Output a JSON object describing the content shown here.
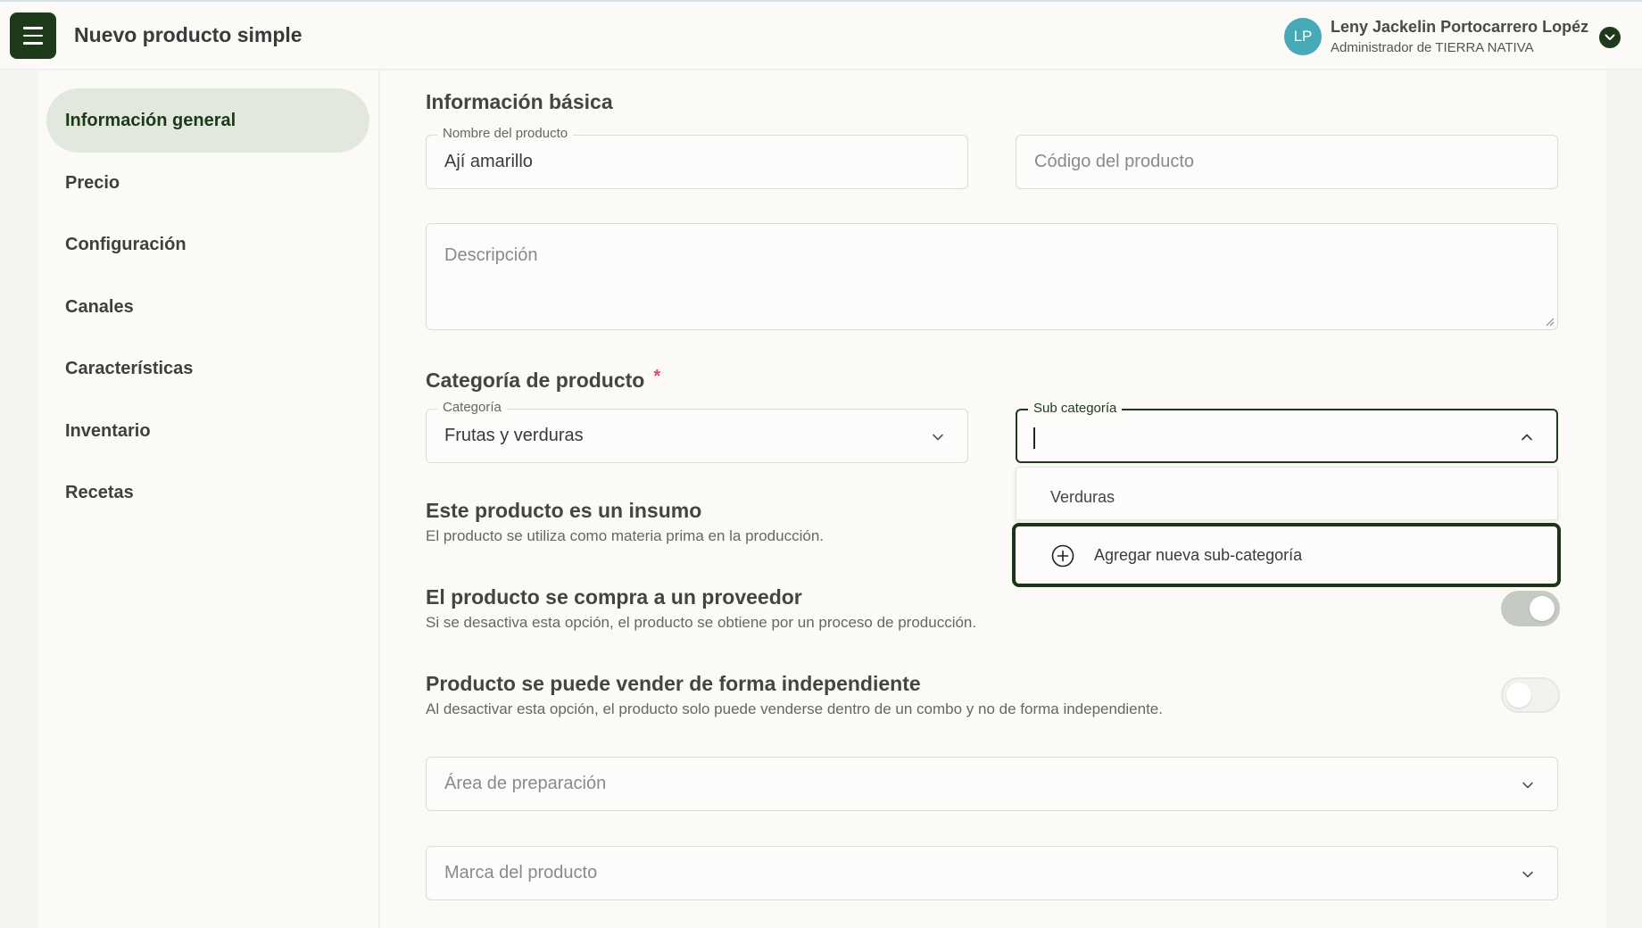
{
  "header": {
    "title": "Nuevo producto simple",
    "user": {
      "initials": "LP",
      "name": "Leny Jackelin Portocarrero Lopéz",
      "role": "Administrador de TIERRA NATIVA"
    }
  },
  "sidebar": {
    "items": [
      {
        "label": "Información general",
        "active": true
      },
      {
        "label": "Precio"
      },
      {
        "label": "Configuración"
      },
      {
        "label": "Canales"
      },
      {
        "label": "Características"
      },
      {
        "label": "Inventario"
      },
      {
        "label": "Recetas"
      }
    ]
  },
  "basic_info": {
    "title": "Información básica",
    "product_name": {
      "label": "Nombre del producto",
      "value": "Ají amarillo"
    },
    "product_code": {
      "placeholder": "Código del producto"
    },
    "description": {
      "placeholder": "Descripción"
    }
  },
  "category": {
    "title": "Categoría de producto",
    "required_mark": "*",
    "category_field": {
      "label": "Categoría",
      "value": "Frutas y verduras"
    },
    "subcategory_field": {
      "label": "Sub categoría",
      "value": ""
    },
    "dropdown": {
      "options": [
        "Verduras"
      ],
      "add_label": "Agregar nueva sub-categoría"
    }
  },
  "toggles": [
    {
      "title": "Este producto es un insumo",
      "description": "El producto se utiliza como materia prima en la producción."
    },
    {
      "title": "El producto se compra a un proveedor",
      "description": "Si se desactiva esta opción, el producto se obtiene por un proceso de producción.",
      "enabled": true
    },
    {
      "title": "Producto se puede vender de forma independiente",
      "description": "Al desactivar esta opción, el producto solo puede venderse dentro de un combo y no de forma independiente.",
      "enabled": false
    }
  ],
  "selects": {
    "prep_area": {
      "placeholder": "Área de preparación"
    },
    "brand": {
      "placeholder": "Marca del producto"
    }
  },
  "colors": {
    "brand_dark_green": "#1f3a1a",
    "active_nav_bg": "#e2e8de",
    "avatar": "#47a9b6",
    "required": "#e0457b"
  }
}
